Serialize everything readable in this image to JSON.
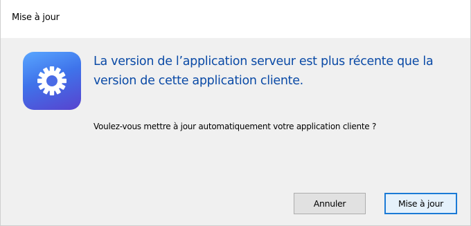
{
  "window": {
    "title": "Mise à jour"
  },
  "dialog": {
    "icon": "gear-icon",
    "headline": "La version de l’application serveur est plus récente que la version de cette application cliente.",
    "question": "Voulez-vous mettre à jour automatiquement votre application cliente ?",
    "cancel_label": "Annuler",
    "ok_label": "Mise à jour"
  },
  "colors": {
    "headline": "#0a4aa6",
    "icon_gradient_top": "#59a6ff",
    "icon_gradient_bottom": "#5843cf",
    "default_button_border": "#1a7ad6"
  }
}
